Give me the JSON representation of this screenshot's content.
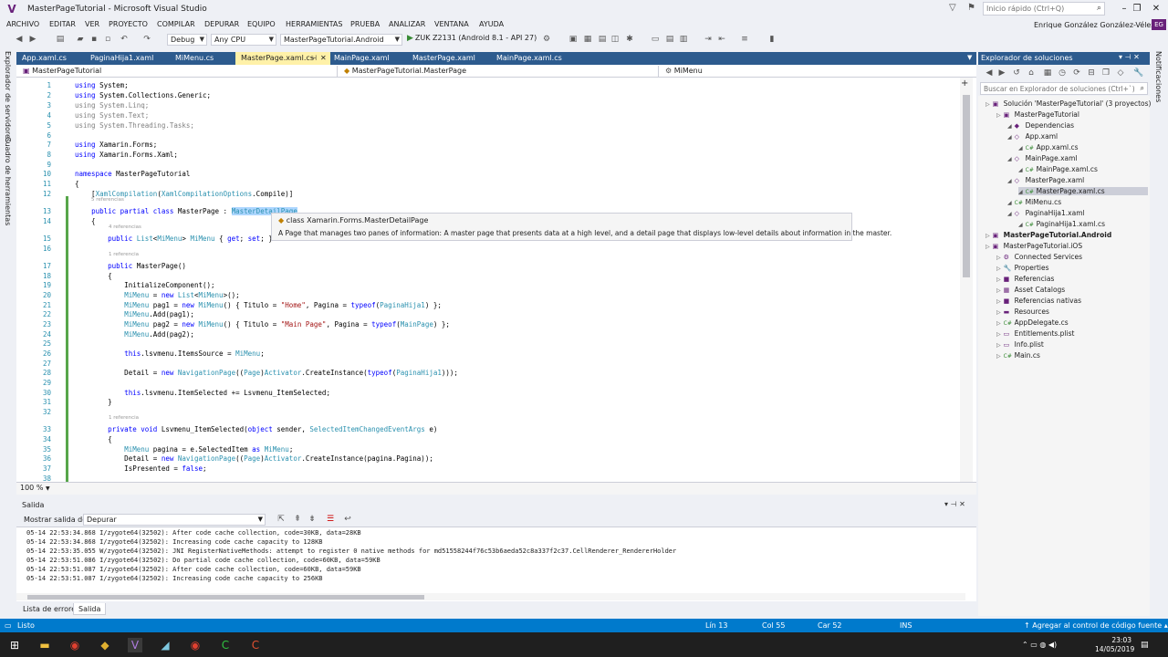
{
  "window": {
    "title": "MasterPageTutorial - Microsoft Visual Studio",
    "quick_launch_placeholder": "Inicio rápido (Ctrl+Q)",
    "user_name": "Enrique González González-Vélez",
    "avatar_initials": "EG"
  },
  "menu": [
    "ARCHIVO",
    "EDITAR",
    "VER",
    "PROYECTO",
    "COMPILAR",
    "DEPURAR",
    "EQUIPO",
    "HERRAMIENTAS",
    "PRUEBA",
    "ANALIZAR",
    "VENTANA",
    "AYUDA"
  ],
  "toolbar": {
    "config": "Debug",
    "platform": "Any CPU",
    "startup_project": "MasterPageTutorial.Android",
    "run_target": "ZUK Z2131 (Android 8.1 - API 27)"
  },
  "side_tabs": {
    "left": [
      "Explorador de servidores",
      "Cuadro de herramientas"
    ],
    "right": "Notificaciones"
  },
  "doc_tabs": [
    "App.xaml.cs",
    "PaginaHija1.xaml",
    "MiMenu.cs",
    "MasterPage.xaml.cs",
    "MainPage.xaml",
    "MasterPage.xaml",
    "MainPage.xaml.cs"
  ],
  "nav": {
    "project": "MasterPageTutorial",
    "type": "MasterPageTutorial.MasterPage",
    "member": "MiMenu"
  },
  "code_lines": [
    {
      "n": "1",
      "t": "using System;"
    },
    {
      "n": "2",
      "t": "using System.Collections.Generic;"
    },
    {
      "n": "3",
      "t": "using System.Linq;"
    },
    {
      "n": "4",
      "t": "using System.Text;"
    },
    {
      "n": "5",
      "t": "using System.Threading.Tasks;"
    },
    {
      "n": "6",
      "t": ""
    },
    {
      "n": "7",
      "t": "using Xamarin.Forms;"
    },
    {
      "n": "8",
      "t": "using Xamarin.Forms.Xaml;"
    },
    {
      "n": "9",
      "t": ""
    },
    {
      "n": "10",
      "t": "namespace MasterPageTutorial"
    },
    {
      "n": "11",
      "t": "{"
    },
    {
      "n": "12",
      "t": "    [XamlCompilation(XamlCompilationOptions.Compile)]"
    },
    {
      "n": "13",
      "t": "    public partial class MasterPage : MasterDetailPage"
    },
    {
      "n": "14",
      "t": "    {"
    },
    {
      "n": "15",
      "t": "        public List<MiMenu> MiMenu { get; set; }"
    },
    {
      "n": "16",
      "t": ""
    },
    {
      "n": "17",
      "t": "        public MasterPage()"
    },
    {
      "n": "18",
      "t": "        {"
    },
    {
      "n": "19",
      "t": "            InitializeComponent();"
    },
    {
      "n": "20",
      "t": "            MiMenu = new List<MiMenu>();"
    },
    {
      "n": "21",
      "t": "            MiMenu pag1 = new MiMenu() { Titulo = \"Home\", Pagina = typeof(PaginaHija1) };"
    },
    {
      "n": "22",
      "t": "            MiMenu.Add(pag1);"
    },
    {
      "n": "23",
      "t": "            MiMenu pag2 = new MiMenu() { Titulo = \"Main Page\", Pagina = typeof(MainPage) };"
    },
    {
      "n": "24",
      "t": "            MiMenu.Add(pag2);"
    },
    {
      "n": "25",
      "t": ""
    },
    {
      "n": "26",
      "t": "            this.lsvmenu.ItemsSource = MiMenu;"
    },
    {
      "n": "27",
      "t": ""
    },
    {
      "n": "28",
      "t": "            Detail = new NavigationPage((Page)Activator.CreateInstance(typeof(PaginaHija1)));"
    },
    {
      "n": "29",
      "t": ""
    },
    {
      "n": "30",
      "t": "            this.lsvmenu.ItemSelected += Lsvmenu_ItemSelected;"
    },
    {
      "n": "31",
      "t": "        }"
    },
    {
      "n": "32",
      "t": ""
    },
    {
      "n": "33",
      "t": "        private void Lsvmenu_ItemSelected(object sender, SelectedItemChangedEventArgs e)"
    },
    {
      "n": "34",
      "t": "        {"
    },
    {
      "n": "35",
      "t": "            MiMenu pagina = e.SelectedItem as MiMenu;"
    },
    {
      "n": "36",
      "t": "            Detail = new NavigationPage((Page)Activator.CreateInstance(pagina.Pagina));"
    },
    {
      "n": "37",
      "t": "            IsPresented = false;"
    },
    {
      "n": "38",
      "t": ""
    }
  ],
  "ref_hints": {
    "class": "5 referencias",
    "property": "4 referencias",
    "ctor": "1 referencia",
    "handler": "1 referencia"
  },
  "tooltip": {
    "line1": "class Xamarin.Forms.MasterDetailPage",
    "line2": "A Page that manages two panes of information: A master page that presents data at a high level, and a detail page that displays low-level details about information in the master."
  },
  "zoom": "100 %",
  "output": {
    "title": "Salida",
    "show_from_label": "Mostrar salida de:",
    "show_from_value": "Depurar",
    "lines": [
      "05-14 22:53:34.868 I/zygote64(32502): After code cache collection, code=30KB, data=28KB",
      "05-14 22:53:34.868 I/zygote64(32502): Increasing code cache capacity to 128KB",
      "05-14 22:53:35.055 W/zygote64(32502): JNI RegisterNativeMethods: attempt to register 0 native methods for md51558244f76c53b6aeda52c8a337f2c37.CellRenderer_RendererHolder",
      "05-14 22:53:51.086 I/zygote64(32502): Do partial code cache collection, code=60KB, data=59KB",
      "05-14 22:53:51.087 I/zygote64(32502): After code cache collection, code=60KB, data=59KB",
      "05-14 22:53:51.087 I/zygote64(32502): Increasing code cache capacity to 256KB"
    ]
  },
  "bottom_tabs": [
    "Lista de errores",
    "Salida"
  ],
  "solution_explorer": {
    "title": "Explorador de soluciones",
    "search_placeholder": "Buscar en Explorador de soluciones (Ctrl+`)",
    "nodes": [
      {
        "label": "Solución 'MasterPageTutorial' (3 proyectos)",
        "indent": 0,
        "icon": "▣"
      },
      {
        "label": "MasterPageTutorial",
        "indent": 1,
        "icon": "▣"
      },
      {
        "label": "Dependencias",
        "indent": 2,
        "icon": "◆"
      },
      {
        "label": "App.xaml",
        "indent": 2,
        "icon": "◇"
      },
      {
        "label": "App.xaml.cs",
        "indent": 3,
        "icon": "C#"
      },
      {
        "label": "MainPage.xaml",
        "indent": 2,
        "icon": "◇"
      },
      {
        "label": "MainPage.xaml.cs",
        "indent": 3,
        "icon": "C#"
      },
      {
        "label": "MasterPage.xaml",
        "indent": 2,
        "icon": "◇"
      },
      {
        "label": "MasterPage.xaml.cs",
        "indent": 3,
        "icon": "C#",
        "selected": true
      },
      {
        "label": "MiMenu.cs",
        "indent": 2,
        "icon": "C#"
      },
      {
        "label": "PaginaHija1.xaml",
        "indent": 2,
        "icon": "◇"
      },
      {
        "label": "PaginaHija1.xaml.cs",
        "indent": 3,
        "icon": "C#"
      },
      {
        "label": "MasterPageTutorial.Android",
        "indent": 0,
        "icon": "▣",
        "bold": true
      },
      {
        "label": "MasterPageTutorial.iOS",
        "indent": 0,
        "icon": "▣"
      },
      {
        "label": "Connected Services",
        "indent": 1,
        "icon": "⚙"
      },
      {
        "label": "Properties",
        "indent": 1,
        "icon": "🔧"
      },
      {
        "label": "Referencias",
        "indent": 1,
        "icon": "■"
      },
      {
        "label": "Asset Catalogs",
        "indent": 1,
        "icon": "▦"
      },
      {
        "label": "Referencias nativas",
        "indent": 1,
        "icon": "■"
      },
      {
        "label": "Resources",
        "indent": 1,
        "icon": "▬"
      },
      {
        "label": "AppDelegate.cs",
        "indent": 1,
        "icon": "C#"
      },
      {
        "label": "Entitlements.plist",
        "indent": 1,
        "icon": "▭"
      },
      {
        "label": "Info.plist",
        "indent": 1,
        "icon": "▭"
      },
      {
        "label": "Main.cs",
        "indent": 1,
        "icon": "C#"
      }
    ]
  },
  "status": {
    "ready": "Listo",
    "line": "Lín 13",
    "col": "Col 55",
    "car": "Car 52",
    "ins": "INS",
    "source_control": "Agregar al control de código fuente"
  },
  "clock": {
    "time": "23:03",
    "date": "14/05/2019"
  },
  "colors": {
    "accent": "#007acc",
    "tab_active": "#fff1a8",
    "vs_purple": "#68217a"
  }
}
